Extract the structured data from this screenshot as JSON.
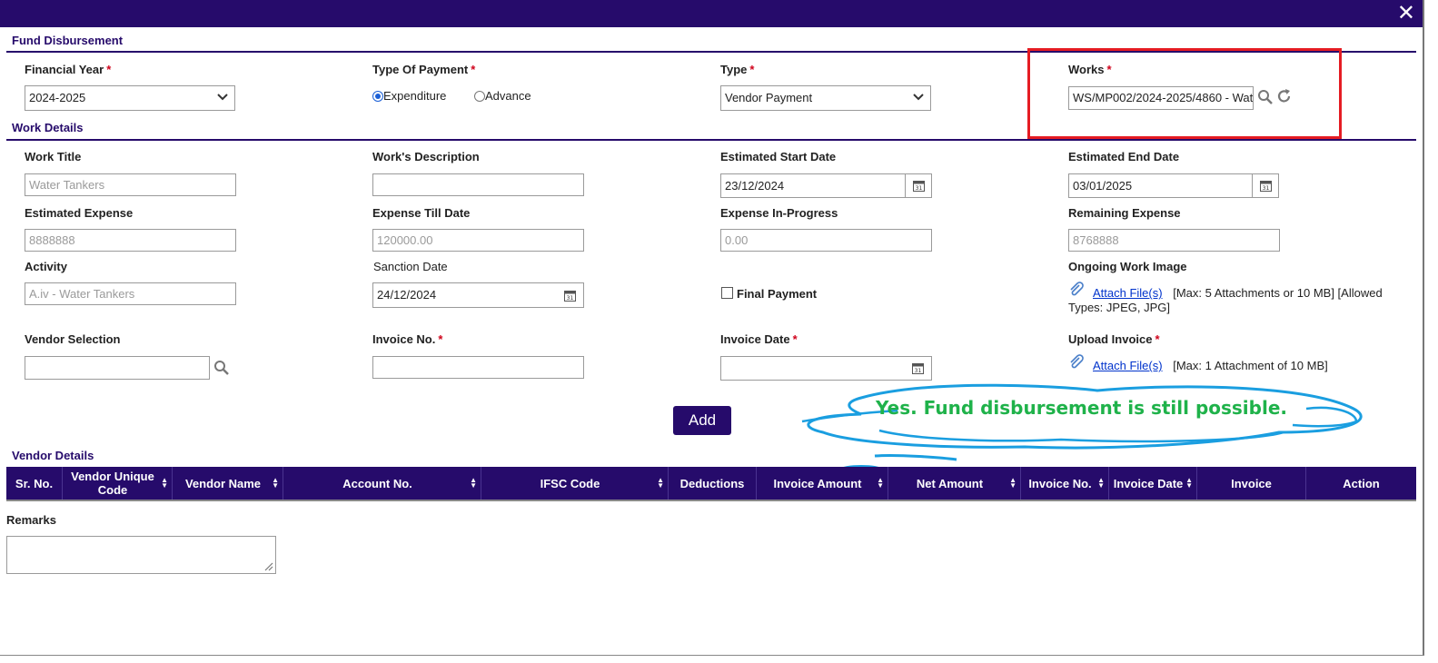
{
  "header": {
    "close_icon": "close-icon",
    "close_label": "✕"
  },
  "fund_disbursement": {
    "section_title": "Fund Disbursement",
    "financial_year": {
      "label": "Financial Year",
      "required": "*",
      "value": "2024-2025"
    },
    "type_of_payment": {
      "label": "Type Of Payment",
      "required": "*",
      "options": [
        "Expenditure",
        "Advance"
      ],
      "selected": "Expenditure"
    },
    "type": {
      "label": "Type",
      "required": "*",
      "value": "Vendor Payment"
    },
    "works": {
      "label": "Works",
      "required": "*",
      "value": "WS/MP002/2024-2025/4860 - Wat"
    }
  },
  "work_details": {
    "section_title": "Work Details",
    "work_title": {
      "label": "Work Title",
      "value": "Water Tankers"
    },
    "works_description": {
      "label": "Work's Description",
      "value": ""
    },
    "estimated_start_date": {
      "label": "Estimated Start Date",
      "value": "23/12/2024"
    },
    "estimated_end_date": {
      "label": "Estimated End Date",
      "value": "03/01/2025"
    },
    "estimated_expense": {
      "label": "Estimated Expense",
      "value": "8888888"
    },
    "expense_till_date": {
      "label": "Expense Till Date",
      "value": "120000.00"
    },
    "expense_in_progress": {
      "label": "Expense In-Progress",
      "value": "0.00"
    },
    "remaining_expense": {
      "label": "Remaining Expense",
      "value": "8768888"
    },
    "activity": {
      "label": "Activity",
      "value": "A.iv - Water Tankers"
    },
    "sanction_date": {
      "label": "Sanction Date",
      "value": "24/12/2024"
    },
    "final_payment": {
      "label": "Final Payment",
      "checked": false
    },
    "ongoing_work_image": {
      "label": "Ongoing Work Image",
      "attach_label": "Attach File(s)",
      "hint_line1": "[Max: 5 Attachments or 10 MB] [Allowed",
      "hint_line2": "Types: JPEG, JPG]"
    },
    "vendor_selection": {
      "label": "Vendor Selection",
      "value": ""
    },
    "invoice_no": {
      "label": "Invoice No.",
      "required": "*",
      "value": ""
    },
    "invoice_date": {
      "label": "Invoice Date",
      "required": "*",
      "value": ""
    },
    "upload_invoice": {
      "label": "Upload Invoice",
      "required": "*",
      "attach_label": "Attach File(s)",
      "hint": "[Max: 1 Attachment of 10 MB]"
    },
    "add_button": "Add"
  },
  "vendor_details": {
    "section_title": "Vendor Details",
    "columns": [
      "Sr. No.",
      "Vendor Unique Code",
      "Vendor Name",
      "Account No.",
      "IFSC Code",
      "Deductions",
      "Invoice Amount",
      "Net Amount",
      "Invoice No.",
      "Invoice Date",
      "Invoice",
      "Action"
    ]
  },
  "remarks": {
    "label": "Remarks",
    "value": ""
  },
  "annotation": {
    "callout_text": "Yes. Fund disbursement is still possible.",
    "highlight_color": "#e51c23",
    "callout_color": "#1a9ee0",
    "text_color": "#1fb24a"
  },
  "colors": {
    "brand": "#260b6b",
    "required": "#d0021b",
    "link": "#0033cc"
  }
}
